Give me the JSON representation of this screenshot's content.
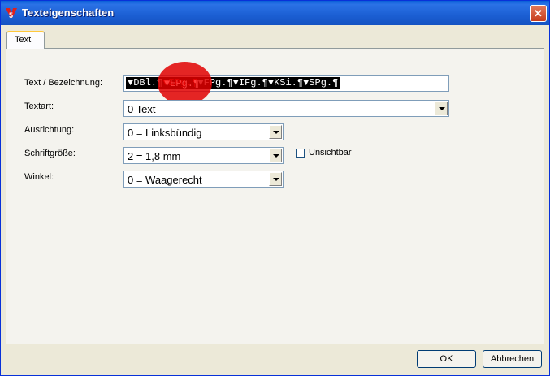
{
  "window": {
    "title": "Texteigenschaften",
    "close_glyph": "✕",
    "app_icon": "app-logo-icon"
  },
  "tabs": [
    {
      "label": "Text"
    }
  ],
  "form": {
    "text_label": "Text / Bezeichnung:",
    "text_segments": [
      "▼DBl.¶",
      "▼EPg.¶",
      "▼FPg.¶",
      "▼IFg.¶",
      "▼KSi.¶",
      "▼SPg.¶"
    ],
    "highlight_text": "▼EPg.¶",
    "textart_label": "Textart:",
    "textart_value": "0 Text",
    "ausrichtung_label": "Ausrichtung:",
    "ausrichtung_value": "0 = Linksbündig",
    "schriftgroesse_label": "Schriftgröße:",
    "schriftgroesse_value": "2 = 1,8 mm",
    "unsichtbar_label": "Unsichtbar",
    "unsichtbar_checked": false,
    "winkel_label": "Winkel:",
    "winkel_value": "0 = Waagerecht"
  },
  "buttons": {
    "ok": "OK",
    "cancel": "Abbrechen"
  },
  "colors": {
    "titlebar": "#1b5fd3",
    "dialog_bg": "#ece9d8",
    "highlight": "#ff2020",
    "marker": "#e10000"
  }
}
